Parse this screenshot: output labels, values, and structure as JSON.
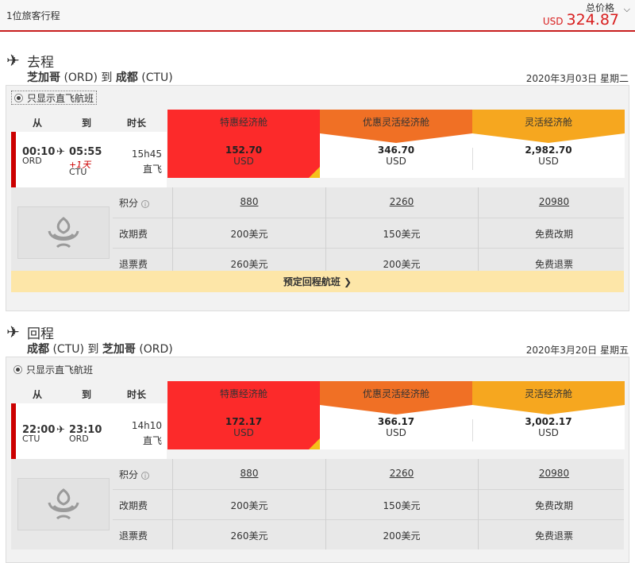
{
  "topbar": {
    "travelers": "1位旅客行程",
    "total_label": "总价格",
    "currency": "USD",
    "total_amount": "324.87"
  },
  "fare_names": [
    "特惠经济舱",
    "优惠灵活经济舱",
    "灵活经济舱"
  ],
  "col_headers": {
    "from": "从",
    "to": "到",
    "duration": "时长"
  },
  "row_labels": {
    "points": "积分",
    "change_fee": "改期费",
    "refund_fee": "退票费"
  },
  "direct_only_label": "只显示直飞航班",
  "outbound": {
    "label": "去程",
    "from_city": "芝加哥",
    "from_code": "(ORD)",
    "connector": "到",
    "to_city": "成都",
    "to_code": "(CTU)",
    "date": "2020年3月03日 星期二",
    "depart_time": "00:10",
    "arrive_time": "05:55",
    "depart_airport": "ORD",
    "arrive_airport": "CTU",
    "day_offset": "+1天",
    "duration": "15h45",
    "stops": "直飞",
    "fares": [
      {
        "amount": "152.70",
        "currency": "USD"
      },
      {
        "amount": "346.70",
        "currency": "USD"
      },
      {
        "amount": "2,982.70",
        "currency": "USD"
      }
    ],
    "points": [
      "880",
      "2260",
      "20980"
    ],
    "change_fee": [
      "200美元",
      "150美元",
      "免费改期"
    ],
    "refund_fee": [
      "260美元",
      "200美元",
      "免费退票"
    ],
    "book_return": "预定回程航班 ❯"
  },
  "return": {
    "label": "回程",
    "from_city": "成都",
    "from_code": "(CTU)",
    "connector": "到",
    "to_city": "芝加哥",
    "to_code": "(ORD)",
    "date": "2020年3月20日 星期五",
    "depart_time": "22:00",
    "arrive_time": "23:10",
    "depart_airport": "CTU",
    "arrive_airport": "ORD",
    "duration": "14h10",
    "stops": "直飞",
    "fares": [
      {
        "amount": "172.17",
        "currency": "USD"
      },
      {
        "amount": "366.17",
        "currency": "USD"
      },
      {
        "amount": "3,002.17",
        "currency": "USD"
      }
    ],
    "points": [
      "880",
      "2260",
      "20980"
    ],
    "change_fee": [
      "200美元",
      "150美元",
      "免费改期"
    ],
    "refund_fee": [
      "260美元",
      "200美元",
      "免费退票"
    ]
  },
  "colors": {
    "accent_red": "#c81e1e",
    "fare_red": "#fc2a2a",
    "fare_orange": "#f07025",
    "fare_yellow": "#f6a71f",
    "book_bar": "#fde6a8"
  },
  "icons": [
    "plane-icon",
    "arrow-plane-icon",
    "chevron-down-icon",
    "info-icon",
    "airline-logo"
  ]
}
